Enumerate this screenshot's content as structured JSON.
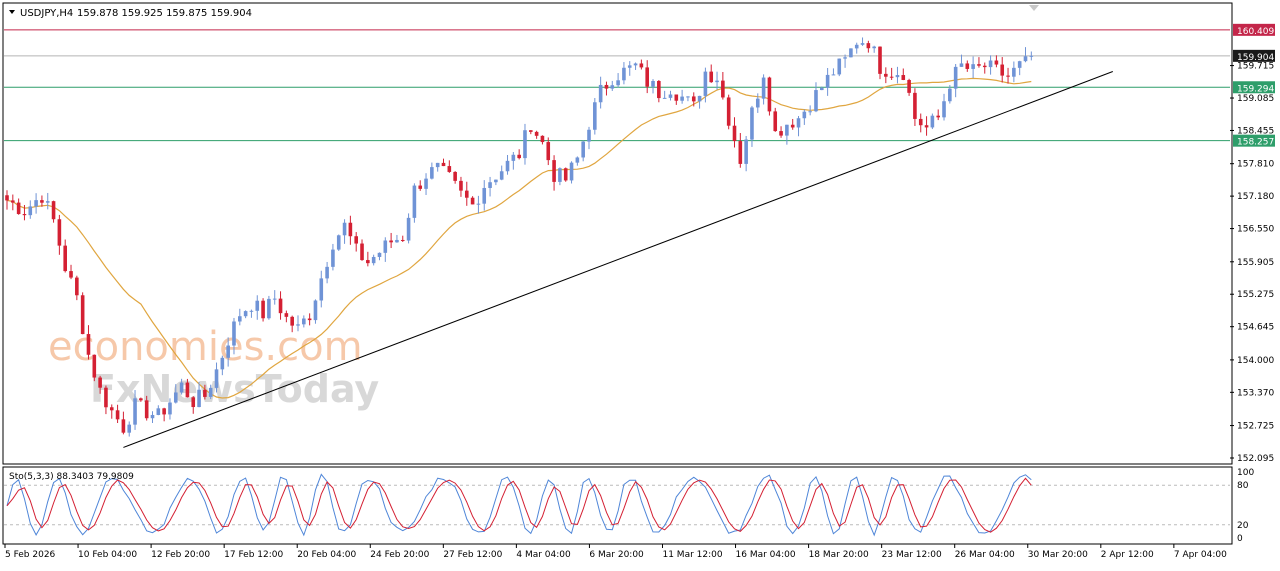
{
  "header": {
    "symbol": "USDJPY,H4",
    "ohlc": "159.878 159.925 159.875 159.904"
  },
  "watermark": {
    "line1": "economies.com",
    "line2": "FxNewsToday"
  },
  "colors": {
    "bull": "#6f93d6",
    "bear": "#d42033",
    "ma": "#e0a640",
    "trendline": "#000000",
    "resistance": "#c4264a",
    "support": "#2e9e6a",
    "current": "#1a1a1a",
    "sto_main": "#4f86d8",
    "sto_signal": "#d42033"
  },
  "chart_data": [
    {
      "type": "candlestick",
      "symbol": "USDJPY",
      "timeframe": "H4",
      "ylim": [
        152.095,
        160.6
      ],
      "price_ticks": [
        159.715,
        159.085,
        158.455,
        157.81,
        157.18,
        156.55,
        155.905,
        155.275,
        154.645,
        154.0,
        153.37,
        152.725,
        152.095
      ],
      "x_labels": [
        "5 Feb 2026",
        "10 Feb 04:00",
        "12 Feb 20:00",
        "17 Feb 12:00",
        "20 Feb 04:00",
        "24 Feb 20:00",
        "27 Feb 12:00",
        "4 Mar 04:00",
        "6 Mar 20:00",
        "11 Mar 12:00",
        "16 Mar 04:00",
        "18 Mar 20:00",
        "23 Mar 12:00",
        "26 Mar 04:00",
        "30 Mar 20:00",
        "2 Apr 12:00",
        "7 Apr 04:00"
      ],
      "levels": [
        {
          "name": "resistance",
          "value": 160.409,
          "label": "160.409"
        },
        {
          "name": "current",
          "value": 159.904,
          "label": "159.904"
        },
        {
          "name": "support-1",
          "value": 159.294,
          "label": "159.294"
        },
        {
          "name": "support-2",
          "value": 158.257,
          "label": "158.257"
        }
      ],
      "trendline": {
        "from": {
          "bar": 20,
          "price": 152.3
        },
        "to": {
          "bar": 190,
          "price": 159.6
        }
      },
      "close_path": [
        [
          0,
          157.1
        ],
        [
          3,
          156.9
        ],
        [
          6,
          157.2
        ],
        [
          8,
          156.7
        ],
        [
          10,
          155.8
        ],
        [
          12,
          155.2
        ],
        [
          14,
          154.1
        ],
        [
          16,
          153.4
        ],
        [
          18,
          153.0
        ],
        [
          20,
          152.7
        ],
        [
          22,
          153.1
        ],
        [
          24,
          153.0
        ],
        [
          26,
          152.9
        ],
        [
          28,
          153.2
        ],
        [
          30,
          153.5
        ],
        [
          32,
          153.2
        ],
        [
          34,
          153.3
        ],
        [
          36,
          153.8
        ],
        [
          38,
          154.4
        ],
        [
          40,
          154.9
        ],
        [
          42,
          155.1
        ],
        [
          44,
          154.9
        ],
        [
          46,
          155.2
        ],
        [
          48,
          154.8
        ],
        [
          50,
          154.6
        ],
        [
          52,
          154.9
        ],
        [
          54,
          155.6
        ],
        [
          56,
          156.3
        ],
        [
          58,
          156.6
        ],
        [
          60,
          156.1
        ],
        [
          62,
          155.9
        ],
        [
          64,
          156.1
        ],
        [
          66,
          156.3
        ],
        [
          68,
          156.4
        ],
        [
          70,
          157.3
        ],
        [
          72,
          157.6
        ],
        [
          74,
          157.7
        ],
        [
          76,
          157.5
        ],
        [
          78,
          157.2
        ],
        [
          80,
          157.0
        ],
        [
          82,
          157.4
        ],
        [
          84,
          157.6
        ],
        [
          86,
          157.8
        ],
        [
          88,
          158.0
        ],
        [
          90,
          158.6
        ],
        [
          92,
          158.2
        ],
        [
          94,
          157.6
        ],
        [
          96,
          157.5
        ],
        [
          98,
          157.9
        ],
        [
          100,
          158.6
        ],
        [
          102,
          159.2
        ],
        [
          104,
          159.5
        ],
        [
          106,
          159.6
        ],
        [
          108,
          159.7
        ],
        [
          110,
          159.4
        ],
        [
          112,
          159.2
        ],
        [
          114,
          159.3
        ],
        [
          116,
          159.1
        ],
        [
          118,
          158.9
        ],
        [
          120,
          159.6
        ],
        [
          122,
          159.5
        ],
        [
          124,
          158.7
        ],
        [
          126,
          157.9
        ],
        [
          128,
          158.8
        ],
        [
          130,
          159.6
        ],
        [
          132,
          158.4
        ],
        [
          134,
          158.6
        ],
        [
          136,
          158.7
        ],
        [
          138,
          159.0
        ],
        [
          140,
          159.3
        ],
        [
          142,
          159.6
        ],
        [
          144,
          159.8
        ],
        [
          146,
          160.2
        ],
        [
          148,
          160.2
        ],
        [
          150,
          159.7
        ],
        [
          152,
          159.6
        ],
        [
          154,
          159.6
        ],
        [
          156,
          158.7
        ],
        [
          158,
          158.5
        ],
        [
          160,
          158.7
        ],
        [
          162,
          159.4
        ],
        [
          164,
          159.7
        ],
        [
          166,
          159.6
        ],
        [
          168,
          159.7
        ],
        [
          170,
          159.6
        ],
        [
          172,
          159.5
        ],
        [
          174,
          159.7
        ],
        [
          176,
          159.8
        ]
      ],
      "indicators": {
        "moving_average": "orange line (value not printed)",
        "stochastic": {
          "label": "Sto(5,3,3) 88.3403 79.9809",
          "main": 88.3403,
          "signal": 79.9809,
          "ylim": [
            0,
            100
          ],
          "ticks": [
            100,
            80,
            20,
            0
          ],
          "levels": [
            80,
            20
          ]
        }
      }
    }
  ]
}
